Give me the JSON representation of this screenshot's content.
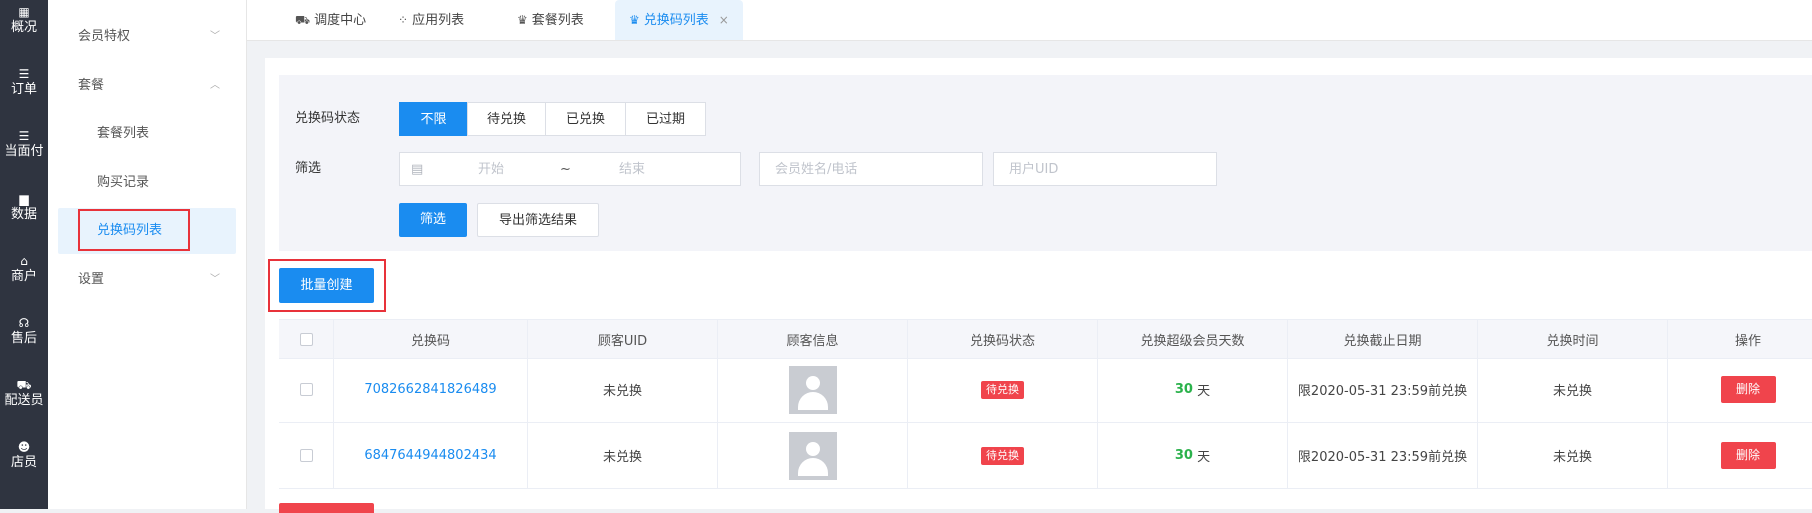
{
  "rail": [
    {
      "icon": "dashboard-icon",
      "glyph": "▦",
      "label": "概况"
    },
    {
      "icon": "list-icon",
      "glyph": "☰",
      "label": "订单"
    },
    {
      "icon": "list-icon",
      "glyph": "☰",
      "label": "当面付"
    },
    {
      "icon": "bar-chart-icon",
      "glyph": "▆",
      "label": "数据"
    },
    {
      "icon": "shop-icon",
      "glyph": "⌂",
      "label": "商户"
    },
    {
      "icon": "headset-icon",
      "glyph": "☊",
      "label": "售后"
    },
    {
      "icon": "delivery-icon",
      "glyph": "⛟",
      "label": "配送员"
    },
    {
      "icon": "staff-icon",
      "glyph": "☻",
      "label": "店员"
    }
  ],
  "submenu": {
    "membership": "会员特权",
    "package": "套餐",
    "package_list": "套餐列表",
    "purchase_records": "购买记录",
    "code_list": "兑换码列表",
    "settings": "设置",
    "chevron_down": "﹀",
    "chevron_up": "︿"
  },
  "tabs": [
    {
      "icon": "truck-icon",
      "glyph": "⛟",
      "label": "调度中心"
    },
    {
      "icon": "apps-icon",
      "glyph": "⁘",
      "label": "应用列表"
    },
    {
      "icon": "crown-icon",
      "glyph": "♛",
      "label": "套餐列表"
    },
    {
      "icon": "crown-icon",
      "glyph": "♛",
      "label": "兑换码列表",
      "close": "×"
    }
  ],
  "filter": {
    "status_label": "兑换码状态",
    "status_options": [
      "不限",
      "待兑换",
      "已兑换",
      "已过期"
    ],
    "selected_status": "不限",
    "screen_label": "筛选",
    "date_icon": "▤",
    "date_start_placeholder": "开始",
    "date_separator": "~",
    "date_end_placeholder": "结束",
    "member_placeholder": "会员姓名/电话",
    "uid_placeholder": "用户UID",
    "filter_button": "筛选",
    "export_button": "导出筛选结果"
  },
  "batch_create": "批量创建",
  "table": {
    "headers": [
      "兑换码",
      "顾客UID",
      "顾客信息",
      "兑换码状态",
      "兑换超级会员天数",
      "兑换截止日期",
      "兑换时间",
      "操作"
    ],
    "rows": [
      {
        "code": "7082662841826489",
        "uid": "未兑换",
        "status": "待兑换",
        "days": "30",
        "days_unit": "天",
        "deadline": "限2020-05-31 23:59前兑换",
        "time": "未兑换",
        "action": "删除"
      },
      {
        "code": "6847644944802434",
        "uid": "未兑换",
        "status": "待兑换",
        "days": "30",
        "days_unit": "天",
        "deadline": "限2020-05-31 23:59前兑换",
        "time": "未兑换",
        "action": "删除"
      }
    ]
  },
  "colors": {
    "accent": "#1a8cf0",
    "danger": "#f0444c",
    "success": "#2bb24c",
    "rail_bg": "#2f3440",
    "highlight_box": "#e8323a"
  }
}
